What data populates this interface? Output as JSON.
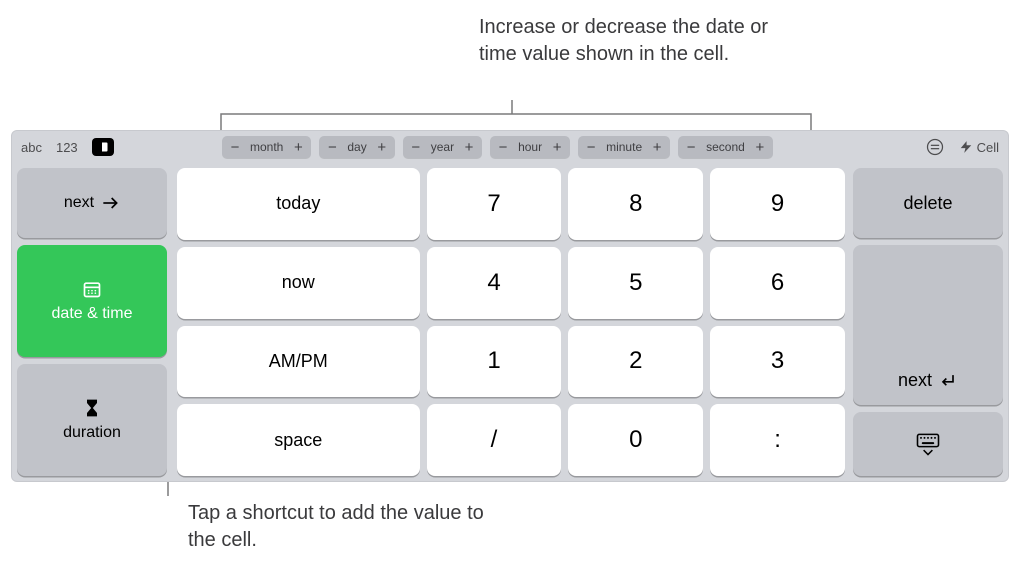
{
  "callouts": {
    "top": "Increase or decrease the date or time value shown in the cell.",
    "bottom": "Tap a shortcut to add the value to the cell."
  },
  "toolbar": {
    "abc": "abc",
    "num": "123",
    "cell": "Cell"
  },
  "steppers": [
    {
      "label": "month"
    },
    {
      "label": "day"
    },
    {
      "label": "year"
    },
    {
      "label": "hour"
    },
    {
      "label": "minute"
    },
    {
      "label": "second"
    }
  ],
  "left": {
    "next": "next",
    "date_time": "date & time",
    "duration": "duration"
  },
  "shortcut": {
    "today": "today",
    "now": "now",
    "ampm": "AM/PM",
    "space": "space"
  },
  "digits": {
    "d7": "7",
    "d8": "8",
    "d9": "9",
    "d4": "4",
    "d5": "5",
    "d6": "6",
    "d1": "1",
    "d2": "2",
    "d3": "3",
    "slash": "/",
    "d0": "0",
    "colon": ":"
  },
  "right": {
    "delete": "delete",
    "next": "next"
  }
}
